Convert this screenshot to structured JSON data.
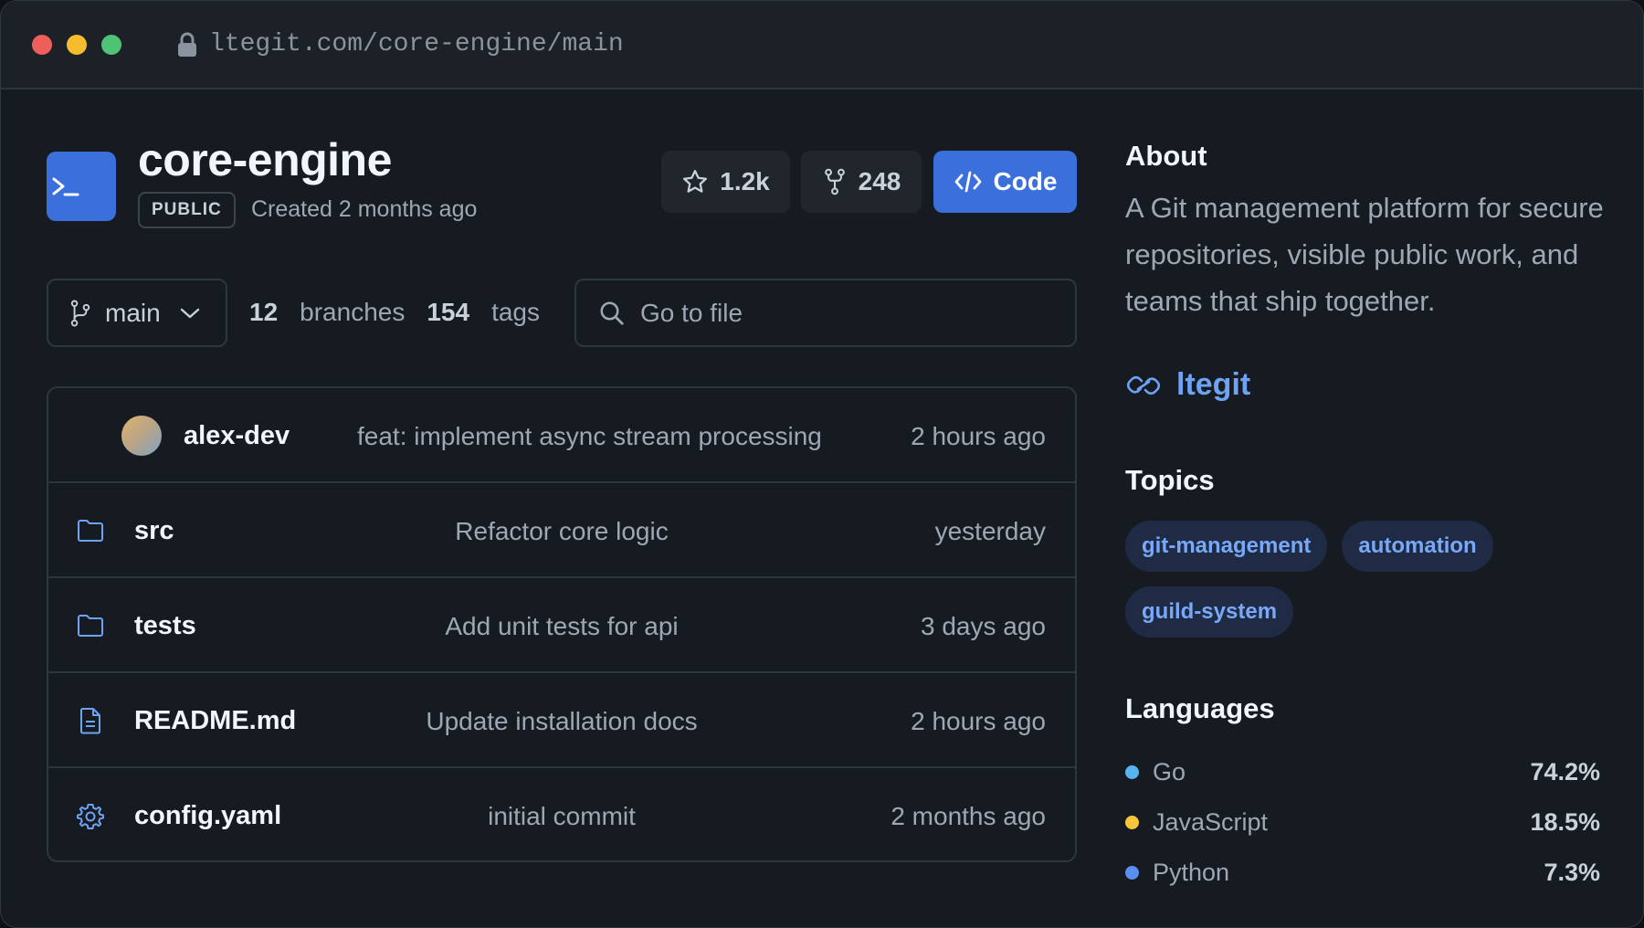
{
  "browser": {
    "url": "ltegit.com/core-engine/main"
  },
  "repo": {
    "name": "core-engine",
    "visibility": "PUBLIC",
    "created": "Created 2 months ago",
    "stars": "1.2k",
    "forks": "248",
    "code_label": "Code"
  },
  "branch": {
    "current": "main",
    "branches_count": "12",
    "branches_label": "branches",
    "tags_count": "154",
    "tags_label": "tags"
  },
  "search": {
    "placeholder": "Go to file"
  },
  "latest_commit": {
    "author": "alex-dev",
    "message": "feat: implement async stream processing",
    "time": "2 hours ago"
  },
  "files": [
    {
      "name": "src",
      "icon": "folder-icon",
      "message": "Refactor core logic",
      "time": "yesterday"
    },
    {
      "name": "tests",
      "icon": "folder-icon",
      "message": "Add unit tests for api",
      "time": "3 days ago"
    },
    {
      "name": "README.md",
      "icon": "file-icon",
      "message": "Update installation docs",
      "time": "2 hours ago"
    },
    {
      "name": "config.yaml",
      "icon": "gear-icon",
      "message": "initial commit",
      "time": "2 months ago"
    }
  ],
  "sidebar": {
    "about_title": "About",
    "description": "A Git management platform for secure repositories, visible public work, and teams that ship together.",
    "link_text": "ltegit",
    "topics_title": "Topics",
    "topics": [
      "git-management",
      "automation",
      "guild-system"
    ],
    "languages_title": "Languages",
    "languages": [
      {
        "name": "Go",
        "percent": "74.2%",
        "color": "#58b4f0"
      },
      {
        "name": "JavaScript",
        "percent": "18.5%",
        "color": "#f5c63c"
      },
      {
        "name": "Python",
        "percent": "7.3%",
        "color": "#5a8ff0"
      }
    ]
  },
  "colors": {
    "accent": "#3b6fdb",
    "link": "#6ea2f5",
    "background": "#161b22"
  }
}
